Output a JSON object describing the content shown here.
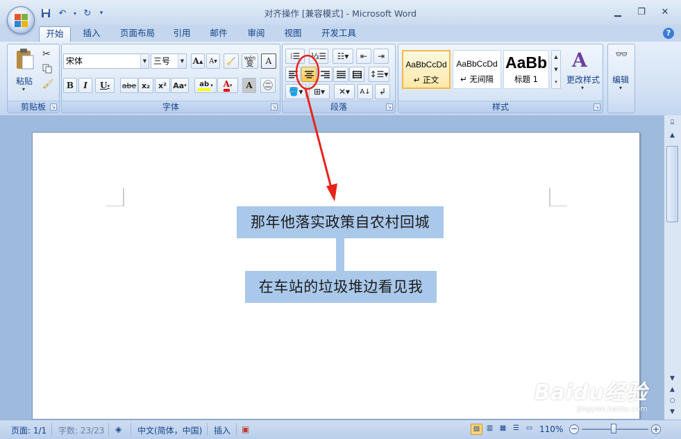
{
  "window": {
    "title": "对齐操作 [兼容模式] - Microsoft Word"
  },
  "tabs": [
    "开始",
    "插入",
    "页面布局",
    "引用",
    "邮件",
    "审阅",
    "视图",
    "开发工具"
  ],
  "clipboard": {
    "paste_label": "粘贴",
    "group_label": "剪贴板"
  },
  "font": {
    "name": "宋体",
    "size": "三号",
    "group_label": "字体",
    "bold": "B",
    "italic": "I",
    "underline": "U",
    "strike": "abe",
    "sub": "x₂",
    "sup": "x²",
    "case": "Aa",
    "grow": "A",
    "shrink": "A",
    "clear": "wén",
    "phonetic": "A",
    "color_a": "A",
    "char_shade": "A"
  },
  "paragraph": {
    "group_label": "段落"
  },
  "styles": {
    "group_label": "样式",
    "items": [
      {
        "sample": "AaBbCcDd",
        "name": "↵ 正文"
      },
      {
        "sample": "AaBbCcDd",
        "name": "↵ 无间隔"
      },
      {
        "sample": "AaBb",
        "name": "标题 1"
      }
    ],
    "change_label": "更改样式"
  },
  "editing": {
    "label": "编辑"
  },
  "document": {
    "lines": [
      "那年他落实政策自农村回城",
      "在车站的垃圾堆边看见我"
    ]
  },
  "status": {
    "page": "页面: 1/1",
    "words": "字数: 23/23",
    "language": "中文(简体，中国)",
    "mode": "插入",
    "zoom": "110%"
  },
  "watermark": {
    "brand": "Baidu经验",
    "url": "jingyan.baidu.com"
  },
  "colors": {
    "highlight": "#a9c8ea",
    "annotation": "#e8231b",
    "accent": "#15428b"
  }
}
